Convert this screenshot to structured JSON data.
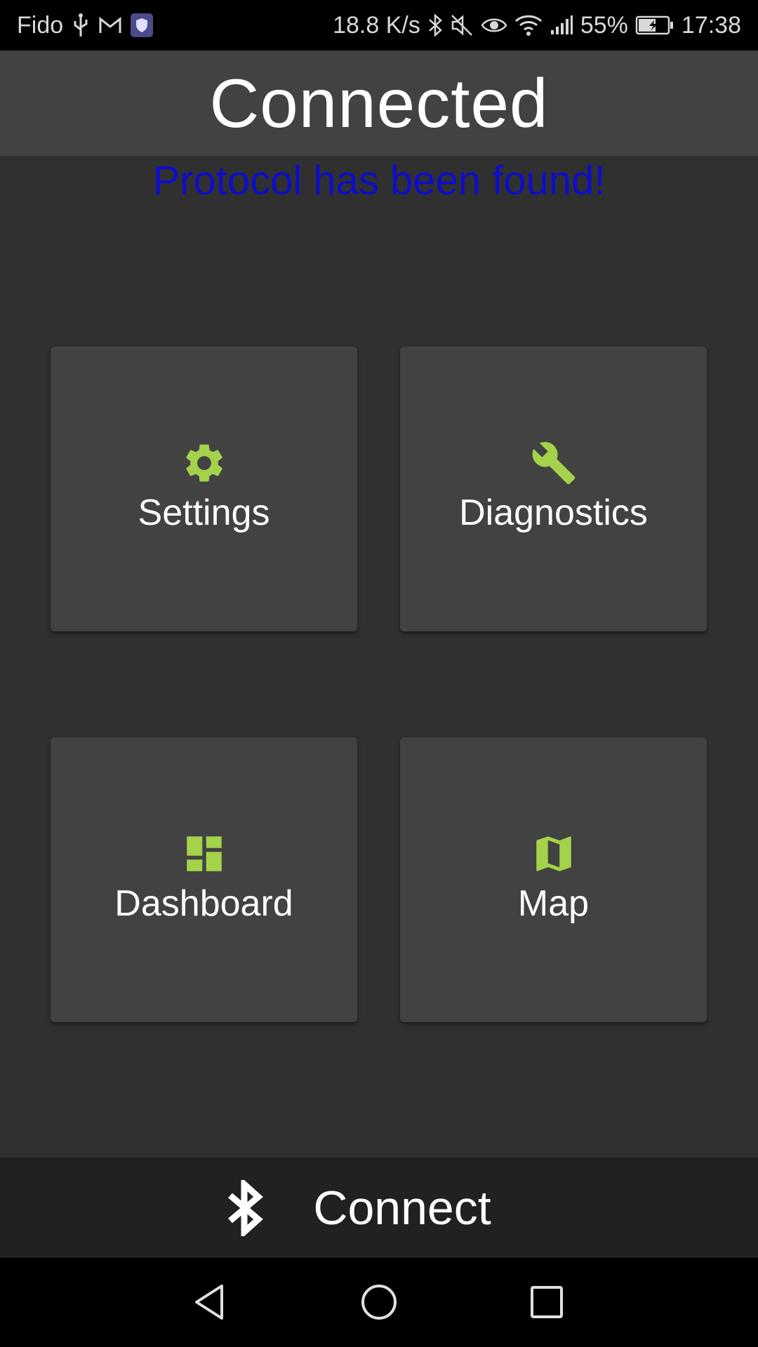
{
  "status_bar": {
    "carrier": "Fido",
    "net_speed": "18.8 K/s",
    "battery": "55%",
    "time": "17:38",
    "icons": [
      "usb-icon",
      "gmail-icon",
      "shield-app-icon",
      "bluetooth-icon",
      "mute-icon",
      "eye-icon",
      "wifi-icon",
      "signal-icon",
      "battery-charging-icon"
    ]
  },
  "header": {
    "title": "Connected"
  },
  "message": {
    "text": "Protocol has been found!",
    "color": "#0d0dc9"
  },
  "tiles": [
    {
      "label": "Settings",
      "icon": "gear-icon"
    },
    {
      "label": "Diagnostics",
      "icon": "wrench-icon"
    },
    {
      "label": "Dashboard",
      "icon": "dashboard-icon"
    },
    {
      "label": "Map",
      "icon": "map-icon"
    }
  ],
  "connect": {
    "label": "Connect",
    "icon": "bluetooth-icon"
  },
  "nav": {
    "icons": [
      "back-icon",
      "home-icon",
      "recents-icon"
    ]
  },
  "colors": {
    "accent": "#a4d24b",
    "background": "#303030",
    "tile": "#424242",
    "header": "#424242",
    "connect_bar": "#212121"
  }
}
